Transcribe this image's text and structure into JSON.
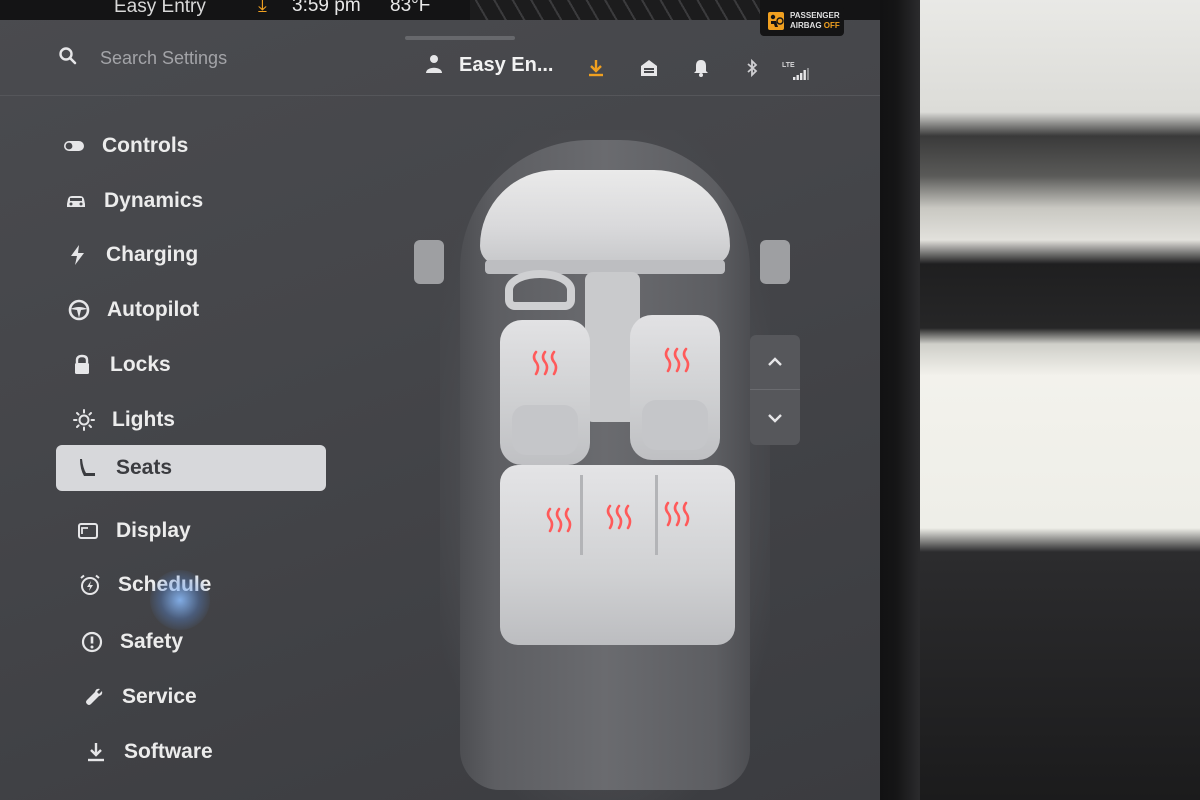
{
  "status_bar": {
    "profile": "Easy Entry",
    "time": "3:59 pm",
    "temperature": "83°F",
    "airbag_line1": "PASSENGER",
    "airbag_line2": "AIRBAG",
    "airbag_state": "OFF",
    "accent_color": "#f0a020"
  },
  "header": {
    "search_placeholder": "Search Settings",
    "profile_name": "Easy En...",
    "icons": [
      "download-icon",
      "garage-icon",
      "bell-icon",
      "bluetooth-icon",
      "lte-signal-icon"
    ],
    "lte_label": "LTE"
  },
  "menu": {
    "items": [
      {
        "label": "Controls",
        "icon": "toggle-icon"
      },
      {
        "label": "Dynamics",
        "icon": "car-icon"
      },
      {
        "label": "Charging",
        "icon": "lightning-icon"
      },
      {
        "label": "Autopilot",
        "icon": "steering-wheel-icon"
      },
      {
        "label": "Locks",
        "icon": "lock-icon"
      },
      {
        "label": "Lights",
        "icon": "sun-icon"
      },
      {
        "label": "Seats",
        "icon": "seat-icon",
        "active": true
      },
      {
        "label": "Display",
        "icon": "display-icon"
      },
      {
        "label": "Schedule",
        "icon": "alarm-clock-icon"
      },
      {
        "label": "Safety",
        "icon": "alert-circle-icon"
      },
      {
        "label": "Service",
        "icon": "wrench-icon"
      },
      {
        "label": "Software",
        "icon": "download-icon"
      }
    ]
  },
  "seats": {
    "heated_seats": [
      "driver",
      "passenger",
      "rear-left",
      "rear-center",
      "rear-right"
    ],
    "heat_color": "#ff5a5a"
  }
}
